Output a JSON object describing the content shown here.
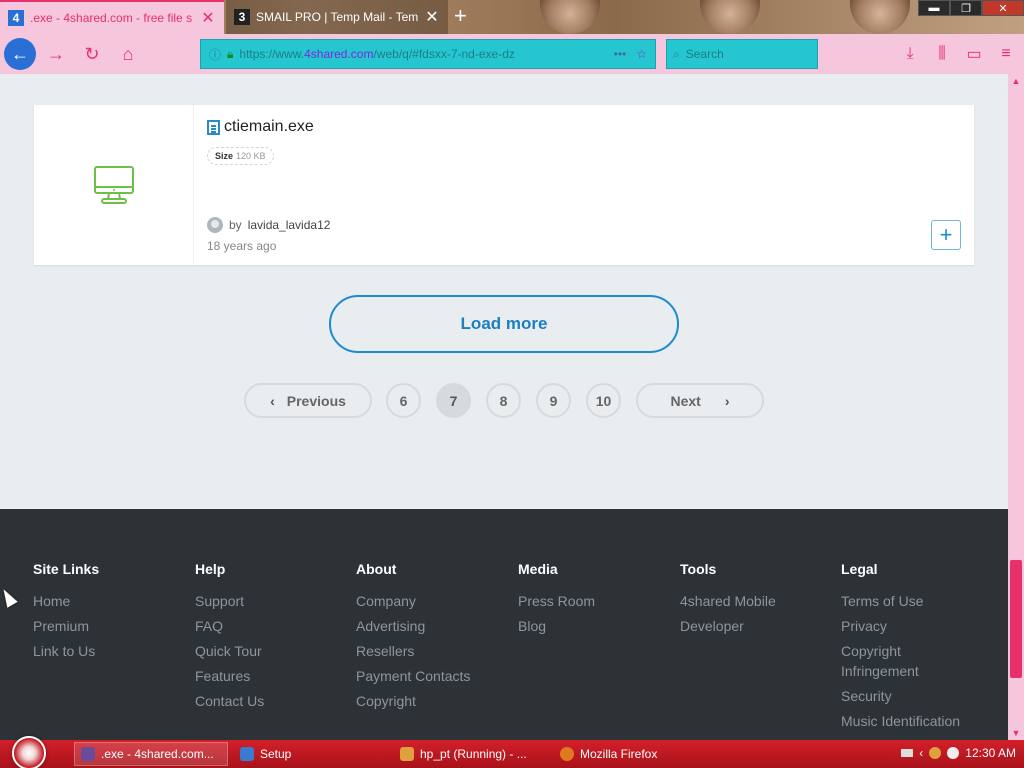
{
  "browser": {
    "tabs": [
      {
        "favicon": "4",
        "title": ".exe - 4shared.com - free file s",
        "active": true
      },
      {
        "favicon": "3",
        "title": "SMAIL PRO | Temp Mail - Tem",
        "active": false
      }
    ],
    "new_tab_icon": "plus-icon",
    "url_host": "4shared.com",
    "url_rest": "/web/q/#fdsxx-7-nd-exe-dz",
    "search_placeholder": "Search"
  },
  "file_card": {
    "name": "ctiemain.exe",
    "size_label": "Size",
    "size_value": "120 KB",
    "by": "by",
    "uploader": "lavida_lavida12",
    "age": "18 years ago",
    "thumb_icon": "desktop-computer-icon",
    "add_icon": "plus-icon"
  },
  "load_more_label": "Load more",
  "pagination": {
    "previous_label": "Previous",
    "next_label": "Next",
    "pages": [
      "6",
      "7",
      "8",
      "9",
      "10"
    ],
    "current": "7"
  },
  "footer": {
    "columns": [
      {
        "title": "Site Links",
        "links": [
          "Home",
          "Premium",
          "Link to Us"
        ]
      },
      {
        "title": "Help",
        "links": [
          "Support",
          "FAQ",
          "Quick Tour",
          "Features",
          "Contact Us"
        ]
      },
      {
        "title": "About",
        "links": [
          "Company",
          "Advertising",
          "Resellers",
          "Payment Contacts",
          "Copyright"
        ]
      },
      {
        "title": "Media",
        "links": [
          "Press Room",
          "Blog"
        ]
      },
      {
        "title": "Tools",
        "links": [
          "4shared Mobile",
          "Developer"
        ]
      },
      {
        "title": "Legal",
        "links": [
          "Terms of Use",
          "Privacy",
          "Copyright Infringement",
          "Security",
          "Music Identification"
        ]
      }
    ]
  },
  "taskbar": {
    "tasks": [
      {
        "label": ".exe - 4shared.com...",
        "active": true
      },
      {
        "label": "Setup",
        "active": false
      },
      {
        "label": "hp_pt (Running) - ...",
        "active": false
      },
      {
        "label": "Mozilla Firefox",
        "active": false
      }
    ],
    "clock": "12:30 AM"
  },
  "colors": {
    "accent": "#1b8bd0",
    "browser_theme": "#f6c6dd",
    "browser_accent": "#e8306a",
    "footer_bg": "#2d3236",
    "taskbar": "#c0101a"
  }
}
